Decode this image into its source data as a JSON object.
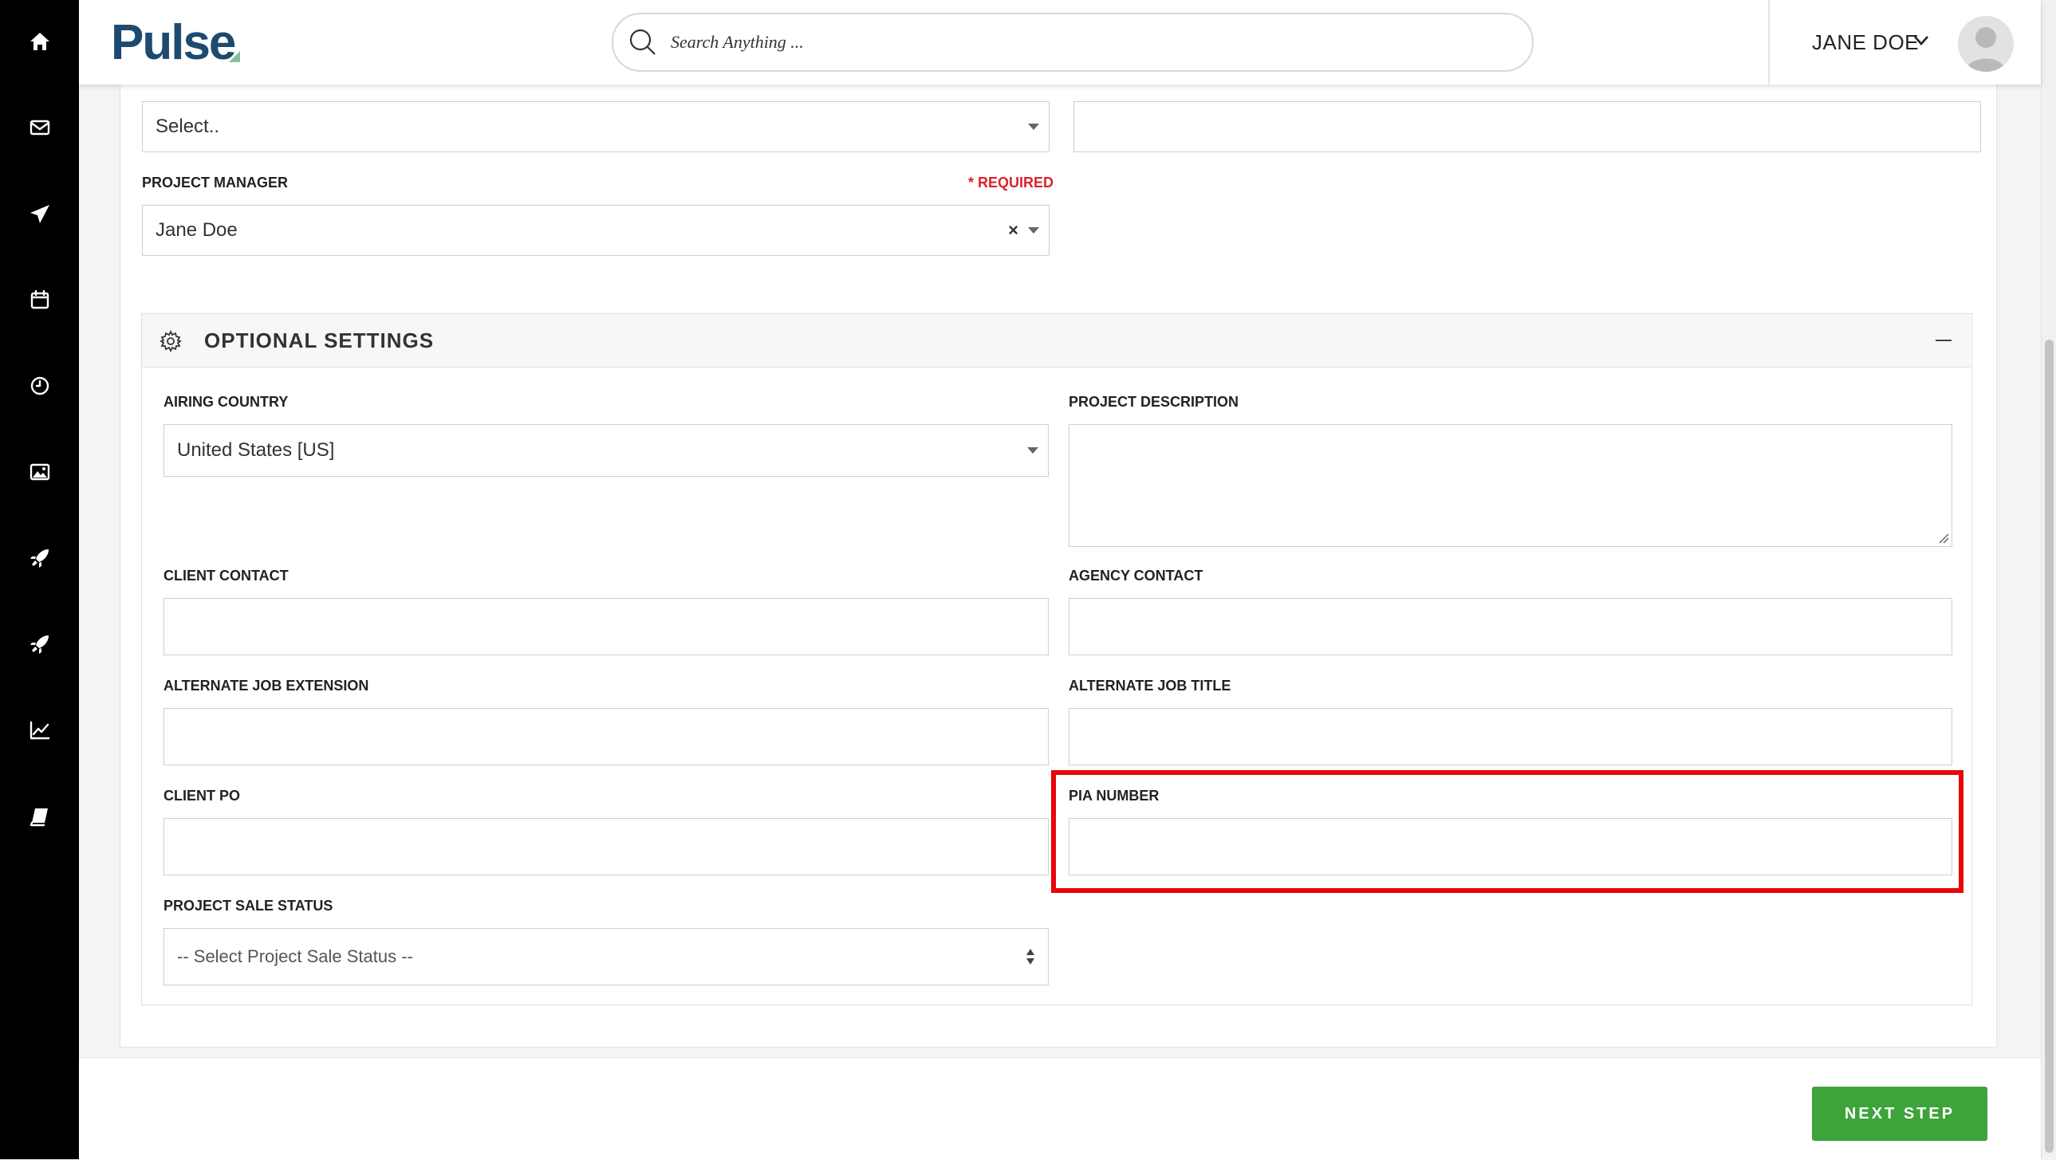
{
  "header": {
    "logo": "Pulse",
    "search_placeholder": "Search Anything ...",
    "user_name": "JANE DOE"
  },
  "sidebar": {
    "items": [
      "home-icon",
      "mail-icon",
      "send-icon",
      "calendar-icon",
      "clock-icon",
      "image-icon",
      "rocket-icon",
      "rocket-alt-icon",
      "chart-icon",
      "book-icon"
    ]
  },
  "form": {
    "brand_value": "Select..",
    "manager_label": "PROJECT MANAGER",
    "manager_required": "* REQUIRED",
    "manager_value": "Jane Doe"
  },
  "optional": {
    "title": "OPTIONAL SETTINGS",
    "airing_country_label": "AIRING COUNTRY",
    "airing_country_value": "United States [US]",
    "project_description_label": "PROJECT DESCRIPTION",
    "client_contact_label": "CLIENT CONTACT",
    "agency_contact_label": "AGENCY CONTACT",
    "alt_job_extension_label": "ALTERNATE JOB EXTENSION",
    "alt_job_title_label": "ALTERNATE JOB TITLE",
    "client_po_label": "CLIENT PO",
    "pia_number_label": "PIA NUMBER",
    "sale_status_label": "PROJECT SALE STATUS",
    "sale_status_value": "-- Select Project Sale Status --"
  },
  "footer": {
    "next_label": "NEXT STEP"
  },
  "colors": {
    "accent": "#3da33b",
    "required": "#d9232d",
    "highlight": "#e8050b",
    "brand": "#1d4a6e"
  }
}
